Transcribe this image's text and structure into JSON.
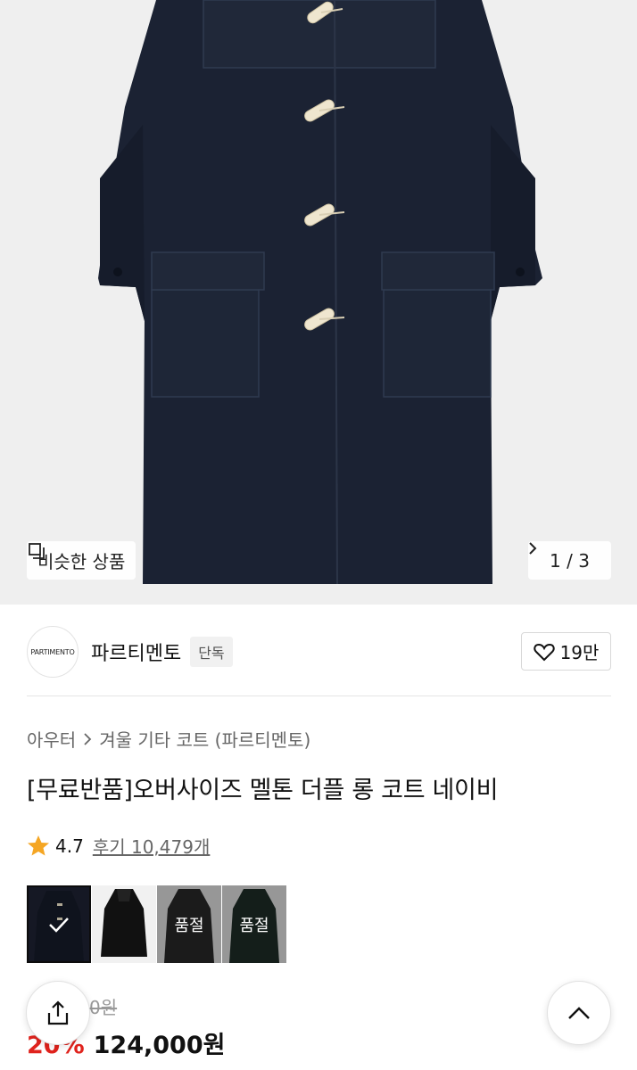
{
  "hero": {
    "similar_label": "비슷한 상품",
    "similar_icon": "similar-items-icon",
    "pager": "1 / 3",
    "pager_icon": "chevron-right-icon"
  },
  "brand": {
    "logo_text": "PARTIMENTO",
    "name": "파르티멘토",
    "badge": "단독",
    "like_count": "19만",
    "like_icon": "heart-icon"
  },
  "breadcrumb": {
    "category": "아우터",
    "subcategory": "겨울 기타 코트 (파르티멘토)"
  },
  "product": {
    "title": "[무료반품]오버사이즈 멜톤 더플 롱 코트 네이비",
    "rating": "4.7",
    "reviews": "후기 10,479개",
    "star_color": "#f5a623",
    "original_price": "155,000원",
    "discount": "20%",
    "price": "124,000원",
    "discount_color": "#e0231d"
  },
  "colors": [
    {
      "selected": true,
      "soldout_label": ""
    },
    {
      "selected": false,
      "soldout_label": ""
    },
    {
      "selected": false,
      "soldout_label": "품절"
    },
    {
      "selected": false,
      "soldout_label": "품절"
    }
  ],
  "floating": {
    "share_icon": "share-icon",
    "top_icon": "chevron-up-icon"
  }
}
